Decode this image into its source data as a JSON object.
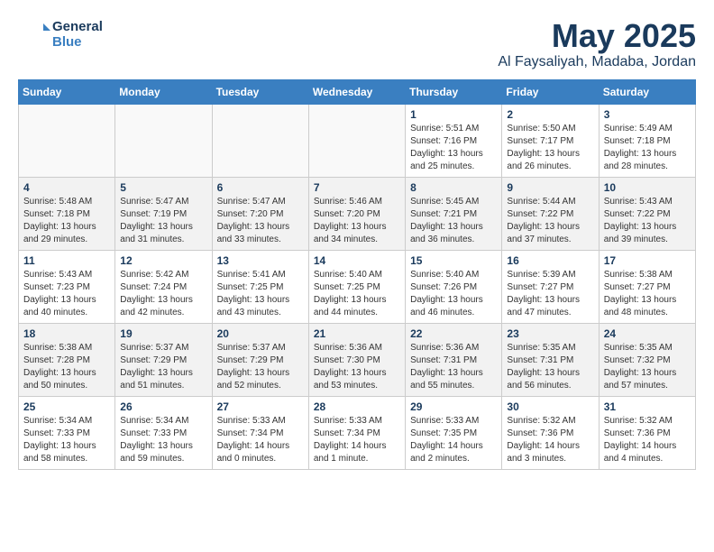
{
  "header": {
    "logo_line1": "General",
    "logo_line2": "Blue",
    "month_title": "May 2025",
    "location": "Al Faysaliyah, Madaba, Jordan"
  },
  "columns": [
    "Sunday",
    "Monday",
    "Tuesday",
    "Wednesday",
    "Thursday",
    "Friday",
    "Saturday"
  ],
  "weeks": [
    [
      {
        "day": "",
        "info": ""
      },
      {
        "day": "",
        "info": ""
      },
      {
        "day": "",
        "info": ""
      },
      {
        "day": "",
        "info": ""
      },
      {
        "day": "1",
        "info": "Sunrise: 5:51 AM\nSunset: 7:16 PM\nDaylight: 13 hours\nand 25 minutes."
      },
      {
        "day": "2",
        "info": "Sunrise: 5:50 AM\nSunset: 7:17 PM\nDaylight: 13 hours\nand 26 minutes."
      },
      {
        "day": "3",
        "info": "Sunrise: 5:49 AM\nSunset: 7:18 PM\nDaylight: 13 hours\nand 28 minutes."
      }
    ],
    [
      {
        "day": "4",
        "info": "Sunrise: 5:48 AM\nSunset: 7:18 PM\nDaylight: 13 hours\nand 29 minutes."
      },
      {
        "day": "5",
        "info": "Sunrise: 5:47 AM\nSunset: 7:19 PM\nDaylight: 13 hours\nand 31 minutes."
      },
      {
        "day": "6",
        "info": "Sunrise: 5:47 AM\nSunset: 7:20 PM\nDaylight: 13 hours\nand 33 minutes."
      },
      {
        "day": "7",
        "info": "Sunrise: 5:46 AM\nSunset: 7:20 PM\nDaylight: 13 hours\nand 34 minutes."
      },
      {
        "day": "8",
        "info": "Sunrise: 5:45 AM\nSunset: 7:21 PM\nDaylight: 13 hours\nand 36 minutes."
      },
      {
        "day": "9",
        "info": "Sunrise: 5:44 AM\nSunset: 7:22 PM\nDaylight: 13 hours\nand 37 minutes."
      },
      {
        "day": "10",
        "info": "Sunrise: 5:43 AM\nSunset: 7:22 PM\nDaylight: 13 hours\nand 39 minutes."
      }
    ],
    [
      {
        "day": "11",
        "info": "Sunrise: 5:43 AM\nSunset: 7:23 PM\nDaylight: 13 hours\nand 40 minutes."
      },
      {
        "day": "12",
        "info": "Sunrise: 5:42 AM\nSunset: 7:24 PM\nDaylight: 13 hours\nand 42 minutes."
      },
      {
        "day": "13",
        "info": "Sunrise: 5:41 AM\nSunset: 7:25 PM\nDaylight: 13 hours\nand 43 minutes."
      },
      {
        "day": "14",
        "info": "Sunrise: 5:40 AM\nSunset: 7:25 PM\nDaylight: 13 hours\nand 44 minutes."
      },
      {
        "day": "15",
        "info": "Sunrise: 5:40 AM\nSunset: 7:26 PM\nDaylight: 13 hours\nand 46 minutes."
      },
      {
        "day": "16",
        "info": "Sunrise: 5:39 AM\nSunset: 7:27 PM\nDaylight: 13 hours\nand 47 minutes."
      },
      {
        "day": "17",
        "info": "Sunrise: 5:38 AM\nSunset: 7:27 PM\nDaylight: 13 hours\nand 48 minutes."
      }
    ],
    [
      {
        "day": "18",
        "info": "Sunrise: 5:38 AM\nSunset: 7:28 PM\nDaylight: 13 hours\nand 50 minutes."
      },
      {
        "day": "19",
        "info": "Sunrise: 5:37 AM\nSunset: 7:29 PM\nDaylight: 13 hours\nand 51 minutes."
      },
      {
        "day": "20",
        "info": "Sunrise: 5:37 AM\nSunset: 7:29 PM\nDaylight: 13 hours\nand 52 minutes."
      },
      {
        "day": "21",
        "info": "Sunrise: 5:36 AM\nSunset: 7:30 PM\nDaylight: 13 hours\nand 53 minutes."
      },
      {
        "day": "22",
        "info": "Sunrise: 5:36 AM\nSunset: 7:31 PM\nDaylight: 13 hours\nand 55 minutes."
      },
      {
        "day": "23",
        "info": "Sunrise: 5:35 AM\nSunset: 7:31 PM\nDaylight: 13 hours\nand 56 minutes."
      },
      {
        "day": "24",
        "info": "Sunrise: 5:35 AM\nSunset: 7:32 PM\nDaylight: 13 hours\nand 57 minutes."
      }
    ],
    [
      {
        "day": "25",
        "info": "Sunrise: 5:34 AM\nSunset: 7:33 PM\nDaylight: 13 hours\nand 58 minutes."
      },
      {
        "day": "26",
        "info": "Sunrise: 5:34 AM\nSunset: 7:33 PM\nDaylight: 13 hours\nand 59 minutes."
      },
      {
        "day": "27",
        "info": "Sunrise: 5:33 AM\nSunset: 7:34 PM\nDaylight: 14 hours\nand 0 minutes."
      },
      {
        "day": "28",
        "info": "Sunrise: 5:33 AM\nSunset: 7:34 PM\nDaylight: 14 hours\nand 1 minute."
      },
      {
        "day": "29",
        "info": "Sunrise: 5:33 AM\nSunset: 7:35 PM\nDaylight: 14 hours\nand 2 minutes."
      },
      {
        "day": "30",
        "info": "Sunrise: 5:32 AM\nSunset: 7:36 PM\nDaylight: 14 hours\nand 3 minutes."
      },
      {
        "day": "31",
        "info": "Sunrise: 5:32 AM\nSunset: 7:36 PM\nDaylight: 14 hours\nand 4 minutes."
      }
    ]
  ]
}
